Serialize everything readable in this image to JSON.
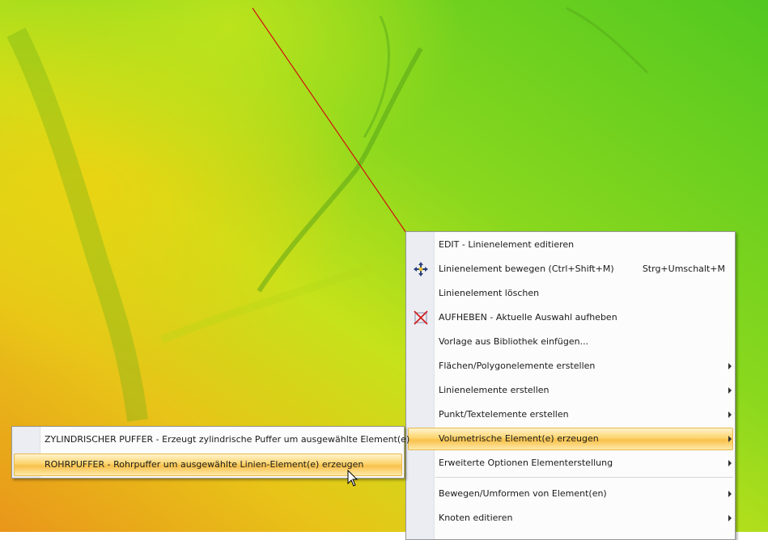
{
  "context_menu": {
    "items": [
      {
        "label": "EDIT - Linienelement editieren",
        "shortcut": "",
        "submenu": false,
        "icon": ""
      },
      {
        "label": "Linienelement bewegen (Ctrl+Shift+M)",
        "shortcut": "Strg+Umschalt+M",
        "submenu": false,
        "icon": "move-arrows-icon"
      },
      {
        "label": "Linienelement löschen",
        "shortcut": "",
        "submenu": false,
        "icon": ""
      },
      {
        "label": "AUFHEBEN - Aktuelle Auswahl aufheben",
        "shortcut": "",
        "submenu": false,
        "icon": "deselect-x-icon"
      },
      {
        "label": "Vorlage aus Bibliothek einfügen...",
        "shortcut": "",
        "submenu": false,
        "icon": ""
      },
      {
        "label": "Flächen/Polygonelemente erstellen",
        "shortcut": "",
        "submenu": true,
        "icon": ""
      },
      {
        "label": "Linienelemente erstellen",
        "shortcut": "",
        "submenu": true,
        "icon": ""
      },
      {
        "label": "Punkt/Textelemente erstellen",
        "shortcut": "",
        "submenu": true,
        "icon": ""
      },
      {
        "label": "Volumetrische Element(e) erzeugen",
        "shortcut": "",
        "submenu": true,
        "icon": "",
        "highlighted": true
      },
      {
        "label": "Erweiterte Optionen Elementerstellung",
        "shortcut": "",
        "submenu": true,
        "icon": ""
      },
      {
        "label": "Bewegen/Umformen von Element(en)",
        "shortcut": "",
        "submenu": true,
        "icon": ""
      },
      {
        "label": "Knoten editieren",
        "shortcut": "",
        "submenu": true,
        "icon": ""
      }
    ]
  },
  "submenu": {
    "items": [
      {
        "label": "ZYLINDRISCHER PUFFER - Erzeugt zylindrische Puffer um ausgewählte Element(e)"
      },
      {
        "label": "ROHRPUFFER - Rohrpuffer um ausgewählte Linien-Element(e) erzeugen",
        "highlighted": true
      }
    ]
  },
  "colors": {
    "highlight": "#f8c14b",
    "menu_background": "#fcfcfc",
    "gutter": "#ebedf2",
    "selected_line": "#d01010"
  }
}
